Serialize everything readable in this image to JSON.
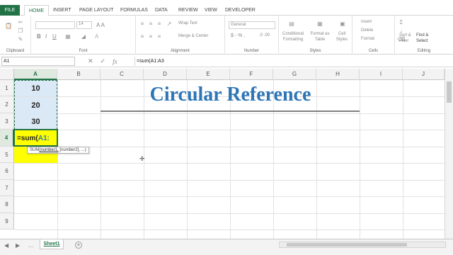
{
  "menu": {
    "file": "FILE",
    "tabs": [
      "HOME",
      "INSERT",
      "PAGE LAYOUT",
      "FORMULAS",
      "DATA",
      "REVIEW",
      "VIEW",
      "DEVELOPER"
    ]
  },
  "ribbon": {
    "clipboard_label": "Clipboard",
    "font_label": "Font",
    "alignment_label": "Alignment",
    "number_label": "Number",
    "styles_label": "Styles",
    "cells_label": "Cells",
    "editing_label": "Editing",
    "wrap_text": "Wrap Text",
    "merge_center": "Merge & Center",
    "number_format": "General",
    "conditional_formatting": "Conditional Formatting",
    "format_as_table": "Format as Table",
    "cell_styles": "Cell Styles",
    "insert": "Insert",
    "delete": "Delete",
    "format": "Format",
    "sort_filter": "Sort & Filter",
    "find_select": "Find & Select",
    "font_size": "14"
  },
  "formula_bar": {
    "name_box": "A1",
    "fx": "fx",
    "formula": "=sum(A1:A3"
  },
  "columns": [
    "A",
    "B",
    "C",
    "D",
    "E",
    "F",
    "G",
    "H",
    "I",
    "J"
  ],
  "rows": [
    "1",
    "2",
    "3",
    "4",
    "5",
    "6",
    "7",
    "8",
    "9"
  ],
  "cells": {
    "a1": "10",
    "a2": "20",
    "a3": "30",
    "a4_prefix": "=sum(",
    "a4_ref": "A1:"
  },
  "tooltip": {
    "func": "SUM",
    "arg1": "(number1,",
    "rest": " [number2], ...)"
  },
  "title": "Circular Reference",
  "status": {
    "sheet_tab": "Sheet1"
  },
  "colors": {
    "accent": "#217346",
    "title": "#2e75b6",
    "highlight": "#ffff00",
    "selection": "#dbe9f6"
  }
}
